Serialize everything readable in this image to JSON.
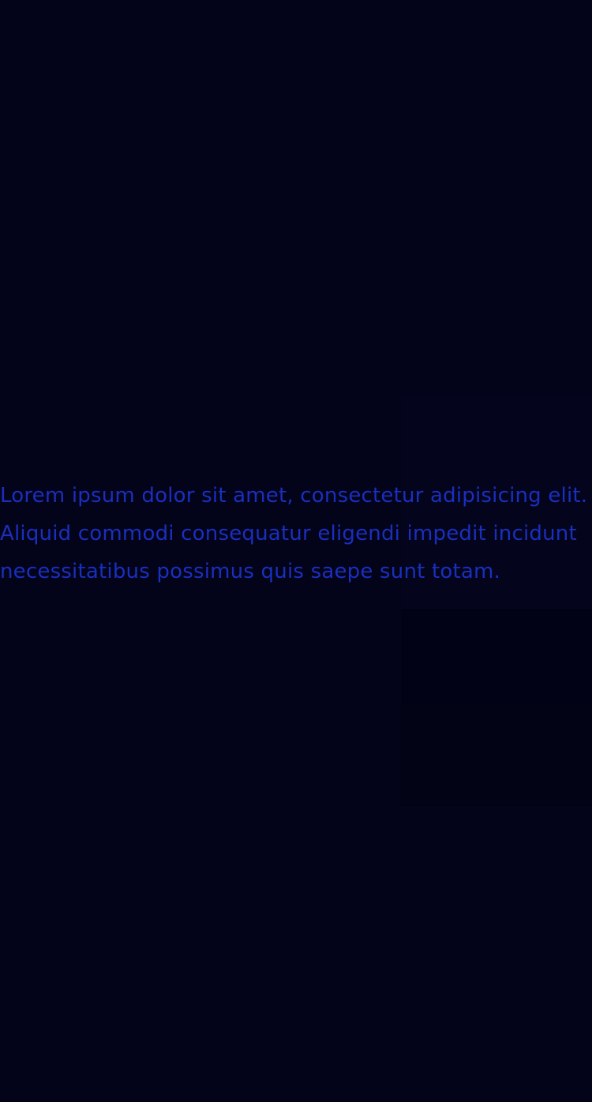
{
  "theme": {
    "background": "#03031a",
    "text_color": "#1a2fbf"
  },
  "main": {
    "paragraph": "Lorem ipsum dolor sit amet, consectetur adipisicing elit. Aliquid commodi consequatur eligendi impedit incidunt necessitatibus possimus quis saepe sunt totam."
  }
}
